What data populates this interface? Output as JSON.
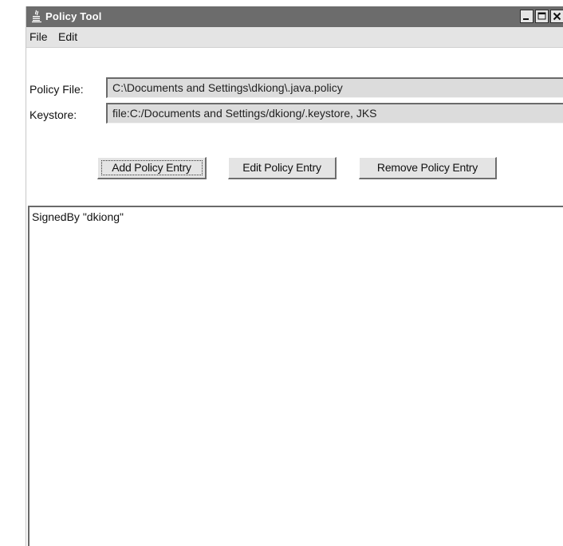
{
  "window": {
    "title": "Policy Tool",
    "controls": [
      "minimize-icon",
      "maximize-icon",
      "close-icon"
    ]
  },
  "menubar": {
    "items": [
      {
        "label": "File"
      },
      {
        "label": "Edit"
      }
    ]
  },
  "fields": {
    "policy_file_label": "Policy File:",
    "policy_file_value": "C:\\Documents and Settings\\dkiong\\.java.policy",
    "keystore_label": "Keystore:",
    "keystore_value": "file:C:/Documents and Settings/dkiong/.keystore, JKS"
  },
  "buttons": {
    "add": "Add Policy Entry",
    "edit": "Edit Policy Entry",
    "remove": "Remove Policy Entry"
  },
  "entries": [
    "SignedBy \"dkiong\""
  ],
  "colors": {
    "titlebar": "#6c6c6c",
    "menubar": "#e4e4e4",
    "field_bg": "#dcdcdc",
    "button_bg": "#e4e4e4"
  }
}
